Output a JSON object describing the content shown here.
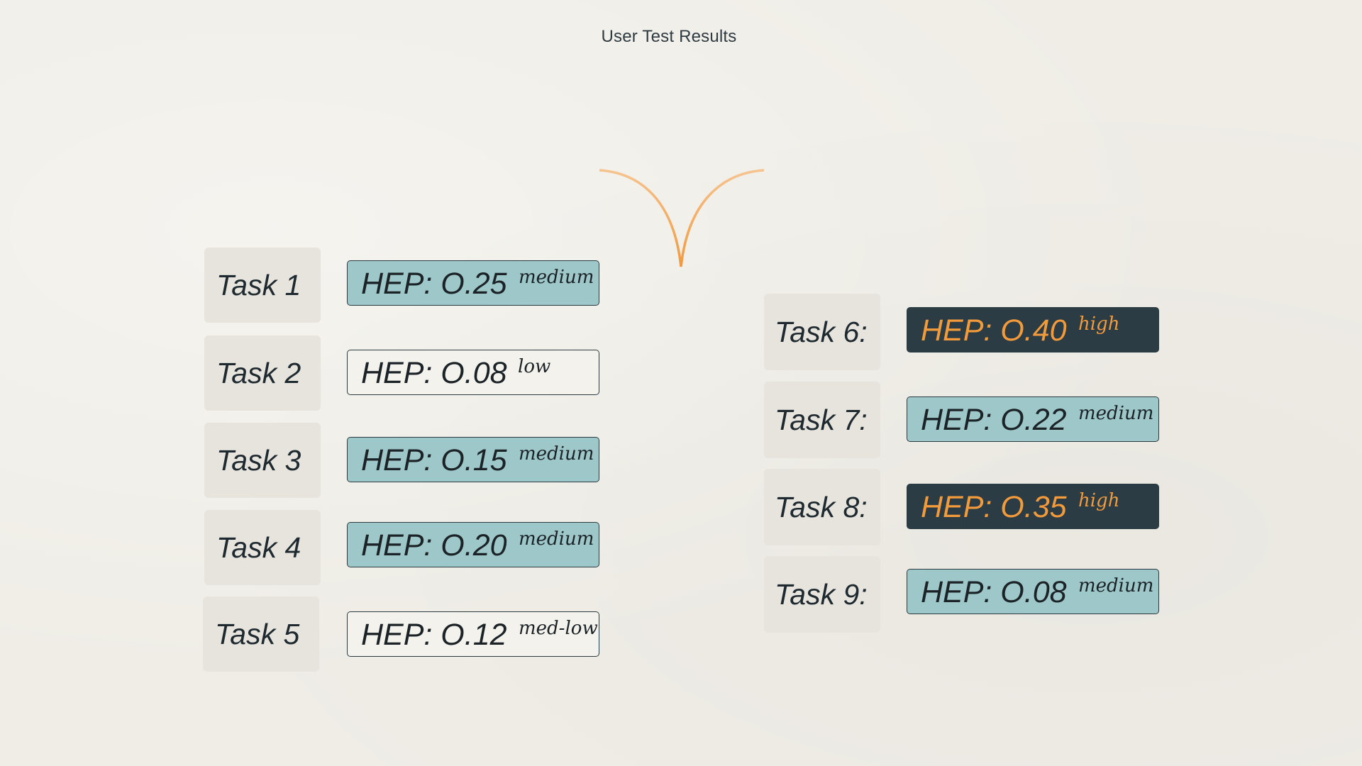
{
  "title": "User Test Results",
  "colors": {
    "background": "#efede6",
    "medium_fill": "#9ec7c9",
    "high_fill": "#2b3c45",
    "high_text": "#f39a3b",
    "connector": "#f19a3e"
  },
  "tasks": [
    {
      "label": "Task 1",
      "hep": "HEP:  O.25",
      "level": "medium"
    },
    {
      "label": "Task 2",
      "hep": "HEP:  O.08",
      "level": "low"
    },
    {
      "label": "Task 3",
      "hep": "HEP:  O.15",
      "level": "medium"
    },
    {
      "label": "Task 4",
      "hep": "HEP:  O.20",
      "level": "medium"
    },
    {
      "label": "Task 5",
      "hep": "HEP:  O.12",
      "level": "med-low"
    },
    {
      "label": "Task 6:",
      "hep": "HEP:  O.40",
      "level": "high"
    },
    {
      "label": "Task 7:",
      "hep": "HEP:  O.22",
      "level": "medium"
    },
    {
      "label": "Task 8:",
      "hep": "HEP:  O.35",
      "level": "high"
    },
    {
      "label": "Task 9:",
      "hep": "HEP:  O.08",
      "level": "medium"
    }
  ]
}
